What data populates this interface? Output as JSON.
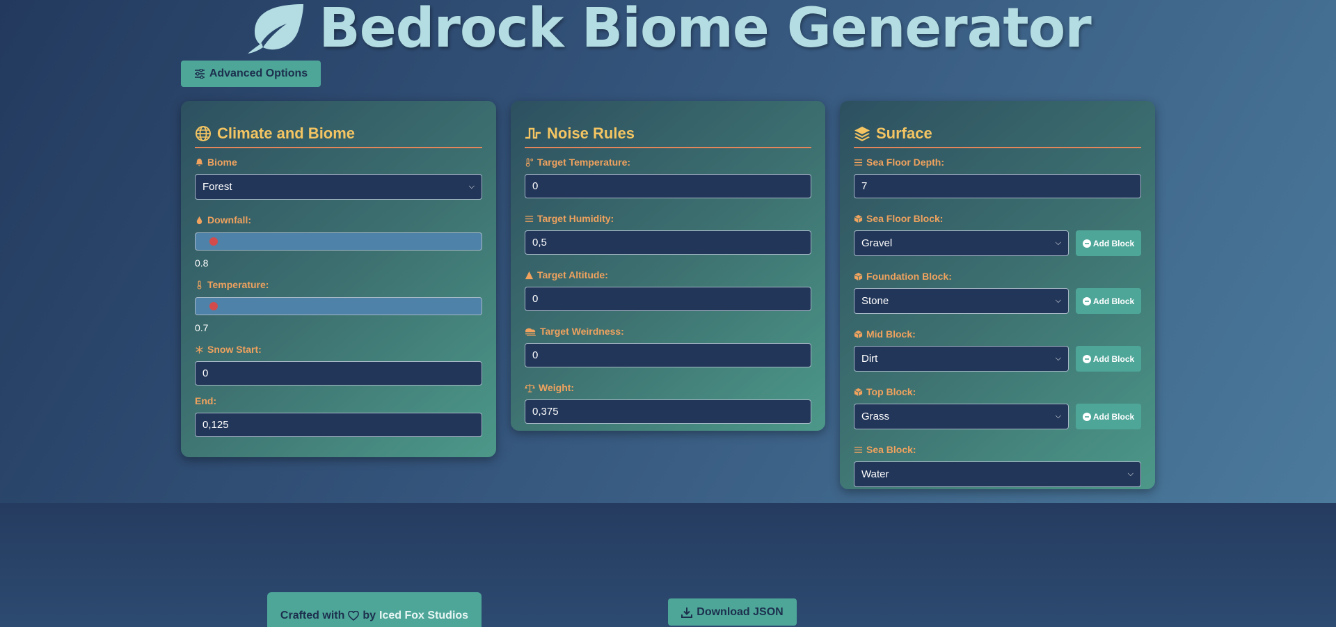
{
  "header": {
    "title": "Bedrock Biome Generator",
    "logo_icon": "leaf-icon"
  },
  "toolbar": {
    "advanced_label": "Advanced Options"
  },
  "climate": {
    "title": "Climate and Biome",
    "biome_label": "Biome",
    "biome_value": "Forest",
    "downfall_label": "Downfall:",
    "downfall_value": "0.8",
    "downfall_level": 0.03,
    "temperature_label": "Temperature:",
    "temperature_value": "0.7",
    "temperature_level": 0.03,
    "snow_start_label": "Snow Start:",
    "snow_start_value": "0",
    "end_label": "End:",
    "end_value": "0,125"
  },
  "noise": {
    "title": "Noise Rules",
    "temperature_label": "Target Temperature:",
    "temperature_value": "0",
    "humidity_label": "Target Humidity:",
    "humidity_value": "0,5",
    "altitude_label": "Target Altitude:",
    "altitude_value": "0",
    "weirdness_label": "Target Weirdness:",
    "weirdness_value": "0",
    "weight_label": "Weight:",
    "weight_value": "0,375"
  },
  "surface": {
    "title": "Surface",
    "sea_floor_depth_label": "Sea Floor Depth:",
    "sea_floor_depth_value": "7",
    "sea_floor_block_label": "Sea Floor Block:",
    "sea_floor_block_value": "Gravel",
    "foundation_block_label": "Foundation Block:",
    "foundation_block_value": "Stone",
    "mid_block_label": "Mid Block:",
    "mid_block_value": "Dirt",
    "top_block_label": "Top Block:",
    "top_block_value": "Grass",
    "sea_block_label": "Sea Block:",
    "sea_block_value": "Water",
    "add_block_label": "Add Block"
  },
  "footer": {
    "crafted_prefix": "Crafted with",
    "crafted_by": "by",
    "studio_name": "Iced Fox Studios",
    "download_label": "Download JSON"
  },
  "colors": {
    "accent": "#4ea699",
    "title": "#b3dde2",
    "heading": "#f4c562",
    "label": "#f0a25e",
    "input_bg": "#223659"
  }
}
